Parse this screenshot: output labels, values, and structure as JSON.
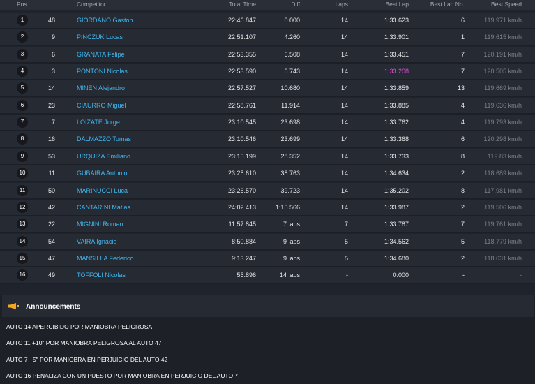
{
  "header": {
    "pos": "Pos",
    "competitor": "Competitor",
    "total_time": "Total Time",
    "diff": "Diff",
    "laps": "Laps",
    "best_lap": "Best Lap",
    "best_lap_no": "Best Lap No.",
    "best_speed": "Best Speed"
  },
  "rows": [
    {
      "pos": "1",
      "num": "48",
      "name": "GIORDANO Gaston",
      "time": "22:46.847",
      "diff": "0.000",
      "laps": "14",
      "best": "1:33.623",
      "blno": "6",
      "speed": "119.971 km/h",
      "best_overall": false
    },
    {
      "pos": "2",
      "num": "9",
      "name": "PINCZUK Lucas",
      "time": "22:51.107",
      "diff": "4.260",
      "laps": "14",
      "best": "1:33.901",
      "blno": "1",
      "speed": "119.615 km/h",
      "best_overall": false
    },
    {
      "pos": "3",
      "num": "6",
      "name": "GRANATA Felipe",
      "time": "22:53.355",
      "diff": "6.508",
      "laps": "14",
      "best": "1:33.451",
      "blno": "7",
      "speed": "120.191 km/h",
      "best_overall": false
    },
    {
      "pos": "4",
      "num": "3",
      "name": "PONTONI Nicolas",
      "time": "22:53.590",
      "diff": "6.743",
      "laps": "14",
      "best": "1:33.208",
      "blno": "7",
      "speed": "120.505 km/h",
      "best_overall": true
    },
    {
      "pos": "5",
      "num": "14",
      "name": "MINEN Alejandro",
      "time": "22:57.527",
      "diff": "10.680",
      "laps": "14",
      "best": "1:33.859",
      "blno": "13",
      "speed": "119.669 km/h",
      "best_overall": false
    },
    {
      "pos": "6",
      "num": "23",
      "name": "CIAURRO Miguel",
      "time": "22:58.761",
      "diff": "11.914",
      "laps": "14",
      "best": "1:33.885",
      "blno": "4",
      "speed": "119.636 km/h",
      "best_overall": false
    },
    {
      "pos": "7",
      "num": "7",
      "name": "LOIZATE Jorge",
      "time": "23:10.545",
      "diff": "23.698",
      "laps": "14",
      "best": "1:33.762",
      "blno": "4",
      "speed": "119.793 km/h",
      "best_overall": false
    },
    {
      "pos": "8",
      "num": "16",
      "name": "DALMAZZO Tomas",
      "time": "23:10.546",
      "diff": "23.699",
      "laps": "14",
      "best": "1:33.368",
      "blno": "6",
      "speed": "120.298 km/h",
      "best_overall": false
    },
    {
      "pos": "9",
      "num": "53",
      "name": "URQUIZA Emiliano",
      "time": "23:15.199",
      "diff": "28.352",
      "laps": "14",
      "best": "1:33.733",
      "blno": "8",
      "speed": "119.83 km/h",
      "best_overall": false
    },
    {
      "pos": "10",
      "num": "11",
      "name": "GUBAIRA Antonio",
      "time": "23:25.610",
      "diff": "38.763",
      "laps": "14",
      "best": "1:34.634",
      "blno": "2",
      "speed": "118.689 km/h",
      "best_overall": false
    },
    {
      "pos": "11",
      "num": "50",
      "name": "MARINUCCI Luca",
      "time": "23:26.570",
      "diff": "39.723",
      "laps": "14",
      "best": "1:35.202",
      "blno": "8",
      "speed": "117.981 km/h",
      "best_overall": false
    },
    {
      "pos": "12",
      "num": "42",
      "name": "CANTARINI Matias",
      "time": "24:02.413",
      "diff": "1:15.566",
      "laps": "14",
      "best": "1:33.987",
      "blno": "2",
      "speed": "119.506 km/h",
      "best_overall": false
    },
    {
      "pos": "13",
      "num": "22",
      "name": "MIGNINI Roman",
      "time": "11:57.845",
      "diff": "7 laps",
      "laps": "7",
      "best": "1:33.787",
      "blno": "7",
      "speed": "119.761 km/h",
      "best_overall": false
    },
    {
      "pos": "14",
      "num": "54",
      "name": "VAIRA Ignacio",
      "time": "8:50.884",
      "diff": "9 laps",
      "laps": "5",
      "best": "1:34.562",
      "blno": "5",
      "speed": "118.779 km/h",
      "best_overall": false
    },
    {
      "pos": "15",
      "num": "47",
      "name": "MANSILLA Federico",
      "time": "9:13.247",
      "diff": "9 laps",
      "laps": "5",
      "best": "1:34.680",
      "blno": "2",
      "speed": "118.631 km/h",
      "best_overall": false
    },
    {
      "pos": "16",
      "num": "49",
      "name": "TOFFOLI Nicolas",
      "time": "55.896",
      "diff": "14 laps",
      "laps": "-",
      "best": "0.000",
      "blno": "-",
      "speed": "-",
      "best_overall": false
    }
  ],
  "announcements": {
    "title": "Announcements",
    "icon": "megaphone-icon",
    "items": [
      "AUTO 14 APERCIBIDO POR MANIOBRA PELIGROSA",
      "AUTO 11 +10\" POR MANIOBRA PELIGROSA AL AUTO 47",
      "AUTO 7 +5\" POR MANIOBRA EN PERJUICIO DEL AUTO 42",
      "AUTO 16 PENALIZA CON UN PUESTO POR MANIOBRA EN PERJUICIO DEL AUTO 7"
    ]
  },
  "colors": {
    "background": "#1f232b",
    "row": "#262a33",
    "name": "#40b7ef",
    "best_overall_lap": "#d94fd6",
    "icon": "#f5a623"
  }
}
